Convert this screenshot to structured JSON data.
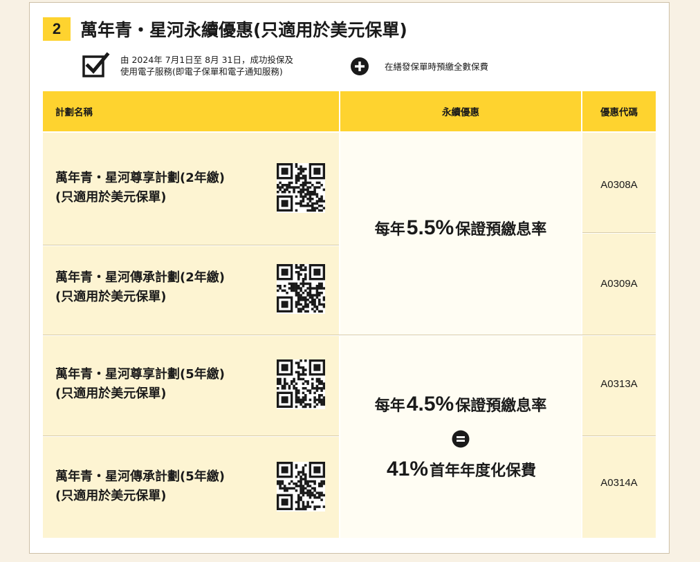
{
  "section": {
    "number": "2",
    "title": "萬年青・星河永續優惠(只適用於美元保單)"
  },
  "conditions": {
    "first_line1": "由 2024年 7月1日至 8月 31日，成功投保及",
    "first_line2": "使用電子服務(即電子保單和電子通知服務)",
    "second": "在繕發保單時預繳全數保費"
  },
  "table": {
    "headers": {
      "plan": "計劃名稱",
      "offer": "永續優惠",
      "code": "優惠代碼"
    },
    "rows": [
      {
        "name_line1": "萬年青・星河尊享計劃(2年繳)",
        "name_line2": "(只適用於美元保單)",
        "code": "A0308A"
      },
      {
        "name_line1": "萬年青・星河傳承計劃(2年繳)",
        "name_line2": "(只適用於美元保單)",
        "code": "A0309A"
      },
      {
        "name_line1": "萬年青・星河尊享計劃(5年繳)",
        "name_line2": "(只適用於美元保單)",
        "code": "A0313A"
      },
      {
        "name_line1": "萬年青・星河傳承計劃(5年繳)",
        "name_line2": "(只適用於美元保單)",
        "code": "A0314A"
      }
    ],
    "offer_2yr": {
      "prefix": "每年",
      "rate": "5.5%",
      "suffix": "保證預繳息率"
    },
    "offer_5yr": {
      "prefix": "每年",
      "rate": "4.5%",
      "suffix": "保證預繳息率",
      "result_value": "41%",
      "result_text": "首年年度化保費"
    }
  },
  "icons": {
    "checkbox": "checkbox-icon",
    "plus": "plus-circle-icon",
    "equals": "equals-circle-icon",
    "qr": "qr-code-icon"
  },
  "colors": {
    "accent_yellow": "#fed32f",
    "row_cream": "#fdf4d2",
    "offer_bg": "#fffdf3",
    "page_bg": "#f8f1e4"
  }
}
